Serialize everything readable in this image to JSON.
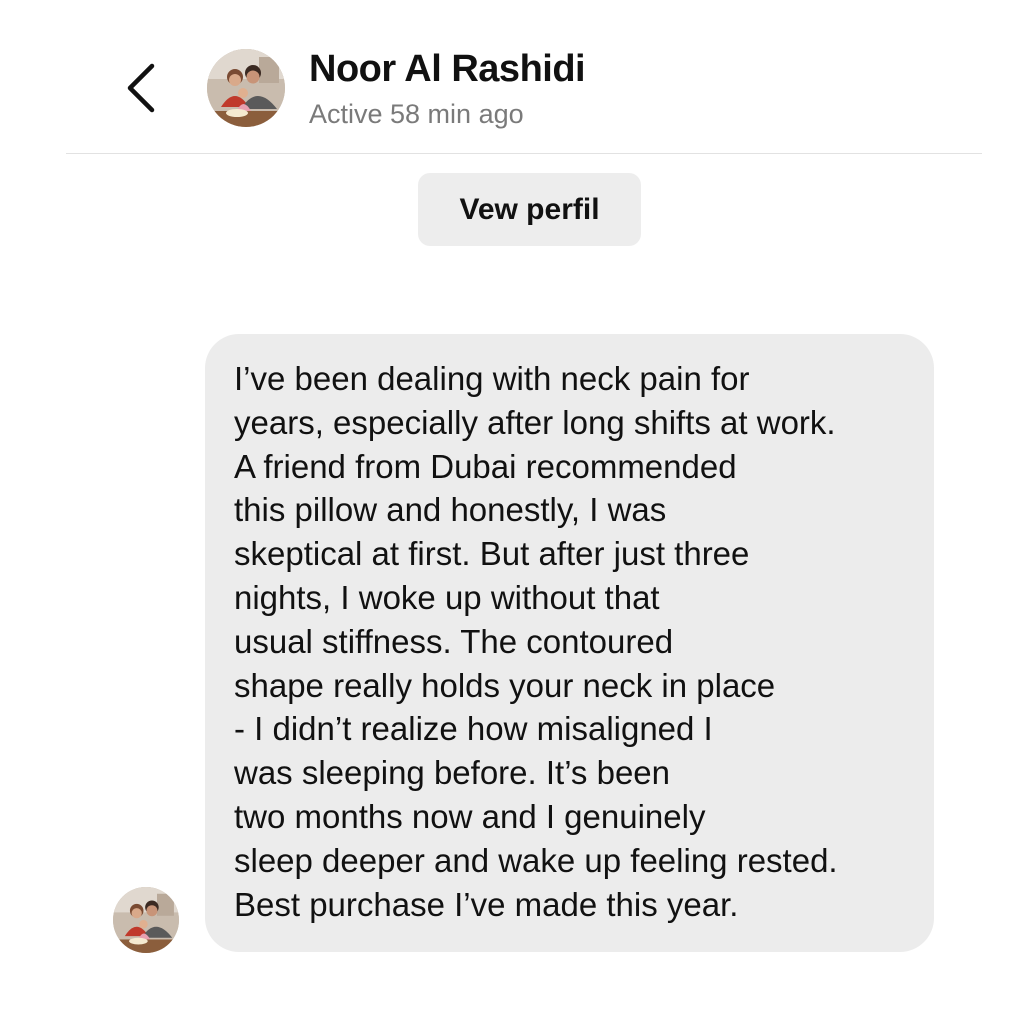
{
  "header": {
    "contact_name": "Noor Al Rashidi",
    "status": "Active 58 min ago",
    "back_icon": "chevron-left-icon"
  },
  "profile_button": {
    "label": "Vew perfil"
  },
  "message": {
    "lines": [
      "I’ve been dealing with neck pain for",
      "years, especially after long shifts at work.",
      "A friend from Dubai recommended",
      "this pillow and honestly, I was",
      "skeptical at first. But after just three",
      "nights, I woke up without that",
      "usual stiffness. The contoured",
      "shape really holds your neck in place",
      "- I didn’t realize how misaligned I",
      "was sleeping before. It’s been",
      "two months now and I genuinely",
      "sleep deeper and wake up feeling rested.",
      "Best purchase I’ve made this year."
    ]
  },
  "colors": {
    "background": "#ffffff",
    "bubble": "#ececec",
    "button": "#ededed",
    "status_text": "#7a7a7a",
    "divider": "#e2e2e2"
  }
}
